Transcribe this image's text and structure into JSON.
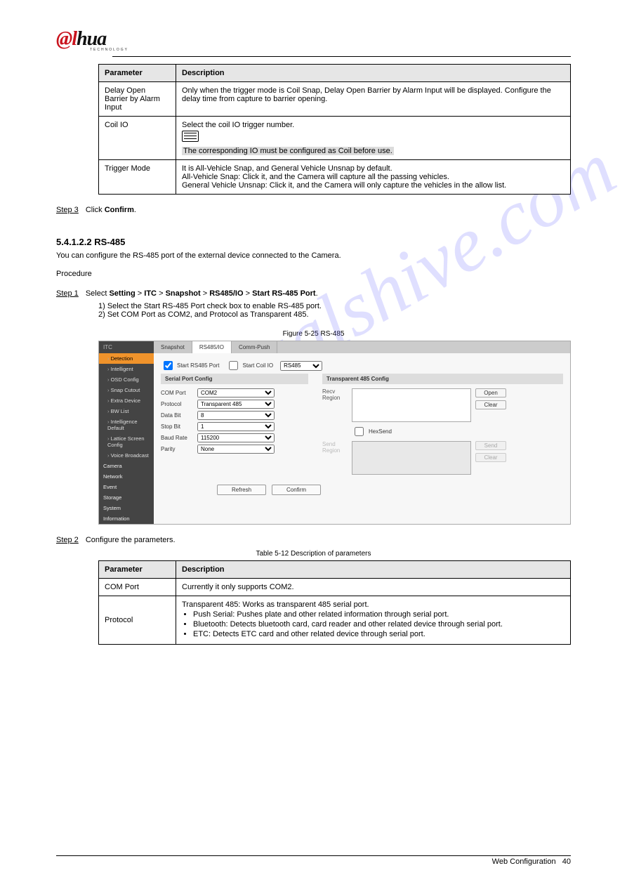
{
  "logo": {
    "brand_a": "@",
    "brand_l": "l",
    "brand_hua": "hua",
    "sub": "TECHNOLOGY"
  },
  "watermark": "manualshive.com",
  "params": {
    "header_param": "Parameter",
    "header_desc": "Description",
    "rows": [
      {
        "param": "Delay Open Barrier by Alarm Input",
        "desc": "Only when the trigger mode is Coil Snap, Delay Open Barrier by Alarm Input will be displayed. Configure the delay time from capture to barrier opening."
      },
      {
        "param": "Coil IO",
        "desc_pre": "Select the coil IO trigger number.",
        "note": "The corresponding IO must be configured as Coil before use."
      },
      {
        "param": "Trigger Mode",
        "desc_lines": [
          "It is All-Vehicle Snap, and General Vehicle Unsnap by default.",
          "All-Vehicle Snap: Click it, and the Camera will capture all the passing vehicles.",
          "General Vehicle Unsnap: Click it, and the Camera will only capture the vehicles in the allow list."
        ]
      }
    ]
  },
  "steps": {
    "step3_label": "Step 3",
    "step3_text": "Click Confirm.",
    "step1_label": "Step 1",
    "step1_text": "Select Setting > ITC > Snapshot > RS485/IO > Start RS-485 Port.",
    "step1_sub1": "1) Select the Start RS-485 Port check box to enable RS-485 port.",
    "step1_sub2": "2) Set COM Port as COM2, and Protocol as Transparent 485.",
    "step2_label": "Step 2",
    "step2_text": "Configure the parameters."
  },
  "section_rs485": {
    "number": "5.4.1.2.2",
    "title": "RS-485",
    "intro": "You can configure the RS-485 port of the external device connected to the Camera.",
    "procedure": "Procedure"
  },
  "figure_caption": "Figure 5-25 RS-485",
  "ui": {
    "itc": "ITC",
    "sidebar": [
      {
        "label": "Detection",
        "active": true
      },
      {
        "label": "Intelligent"
      },
      {
        "label": "OSD Config"
      },
      {
        "label": "Snap Cutout"
      },
      {
        "label": "Extra Device"
      },
      {
        "label": "BW List"
      },
      {
        "label": "Intelligence Default"
      },
      {
        "label": "Lattice Screen Config"
      },
      {
        "label": "Voice Broadcast"
      },
      {
        "label": "Camera",
        "section": true
      },
      {
        "label": "Network",
        "section": true
      },
      {
        "label": "Event",
        "section": true
      },
      {
        "label": "Storage",
        "section": true
      },
      {
        "label": "System",
        "section": true
      },
      {
        "label": "Information",
        "section": true
      }
    ],
    "tabs": {
      "snapshot": "Snapshot",
      "rs485": "RS485/IO",
      "comm": "Comm-Push"
    },
    "start_rs485": "Start RS485 Port",
    "start_coil": "Start Coil IO",
    "io_type": "RS485",
    "pane_serial": "Serial Port Config",
    "pane_trans": "Transparent 485 Config",
    "com_port": {
      "lbl": "COM Port",
      "val": "COM2"
    },
    "protocol": {
      "lbl": "Protocol",
      "val": "Transparent 485"
    },
    "databit": {
      "lbl": "Data Bit",
      "val": "8"
    },
    "stopbit": {
      "lbl": "Stop Bit",
      "val": "1"
    },
    "baud": {
      "lbl": "Baud Rate",
      "val": "115200"
    },
    "parity": {
      "lbl": "Parity",
      "val": "None"
    },
    "recv": "Recv Region",
    "send": "Send Region",
    "hexsend": "HexSend",
    "open": "Open",
    "clear": "Clear",
    "send_btn": "Send",
    "refresh": "Refresh",
    "confirm": "Confirm"
  },
  "table2": {
    "caption": "Table 5-12 Description of parameters",
    "header_param": "Parameter",
    "header_desc": "Description",
    "comport_param": "COM Port",
    "comport_desc": "Currently it only supports COM2.",
    "protocol_param": "Protocol",
    "protocol_intro": "Transparent 485: Works as transparent 485 serial port.",
    "protocol_b1": "Push Serial: Pushes plate and other related information through serial port.",
    "protocol_b2": "Bluetooth: Detects bluetooth card, card reader and other related device through serial port.",
    "protocol_b3": "ETC: Detects ETC card and other related device through serial port."
  },
  "footer": {
    "text": "Web Configuration",
    "page": "40"
  }
}
